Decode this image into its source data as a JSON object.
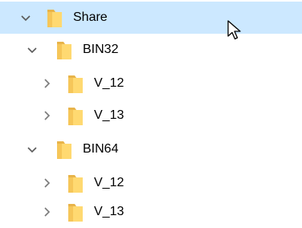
{
  "colors": {
    "selection": "#cce8ff",
    "folder_fill": "#ffd971",
    "folder_back": "#e8b44a",
    "chevron": "#5a5a5a"
  },
  "icons": {
    "expanded": "chevron-down-icon",
    "collapsed": "chevron-right-icon",
    "folder": "folder-icon",
    "cursor": "mouse-pointer-icon"
  },
  "tree": {
    "root": {
      "label": "Share",
      "expanded": true,
      "selected": true
    },
    "bin32": {
      "label": "BIN32",
      "expanded": true
    },
    "bin32_v12": {
      "label": "V_12",
      "expanded": false
    },
    "bin32_v13": {
      "label": "V_13",
      "expanded": false
    },
    "bin64": {
      "label": "BIN64",
      "expanded": true
    },
    "bin64_v12": {
      "label": "V_12",
      "expanded": false
    },
    "bin64_v13": {
      "label": "V_13",
      "expanded": false
    }
  }
}
